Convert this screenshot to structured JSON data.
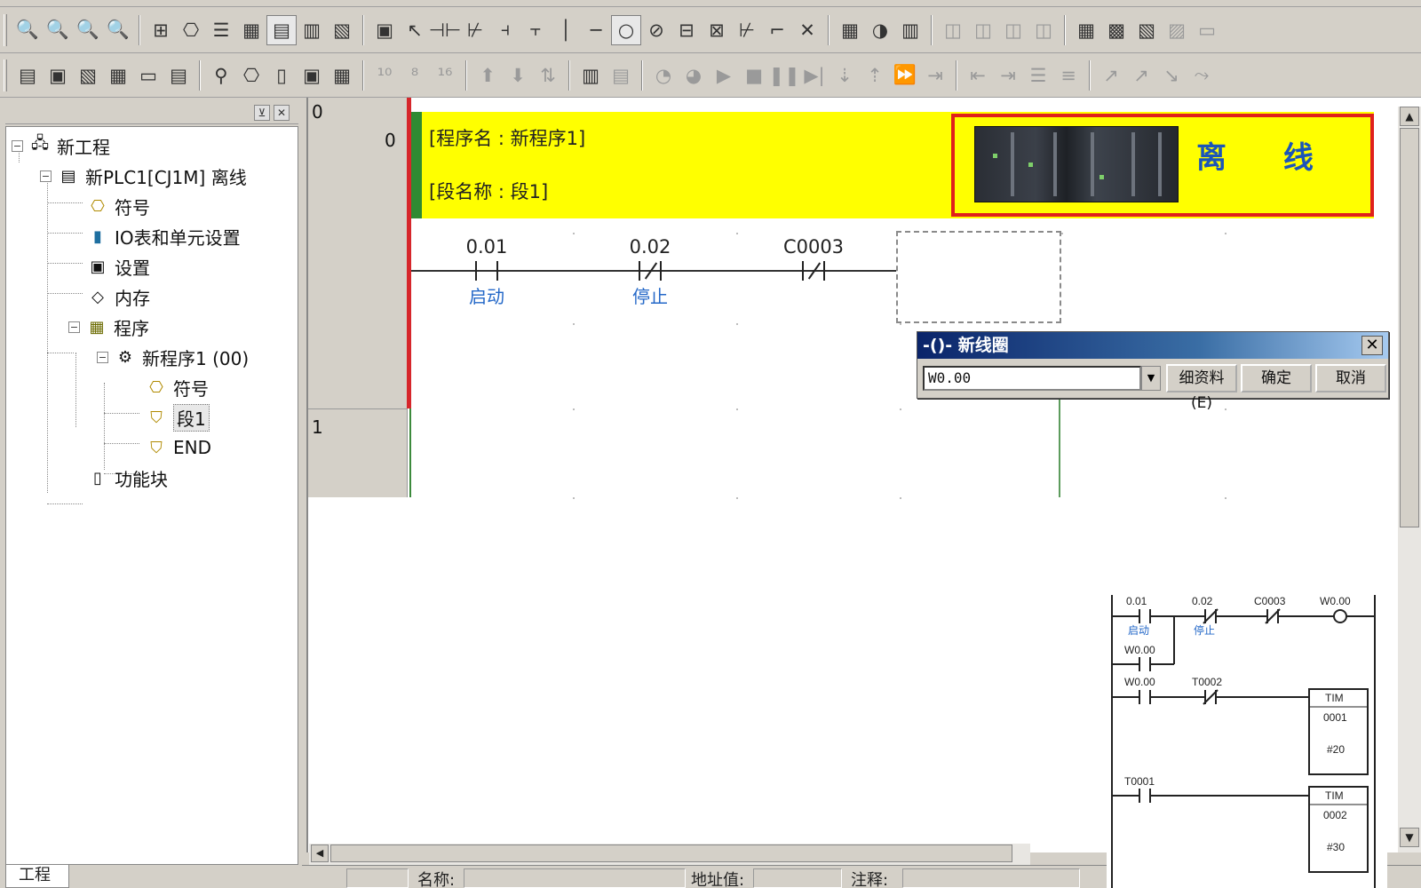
{
  "toolbar": {
    "row1": [
      "zoom-out-icon",
      "zoom-in-icon",
      "zoom-fit-icon",
      "zoom-small-icon",
      "grid-icon",
      "symbol-icon",
      "list-icon",
      "monitor-icon",
      "ladder-view-icon",
      "mnemonic-icon",
      "rung-comment-icon",
      "window-icon",
      "select-icon",
      "no-contact-icon",
      "nc-contact-icon",
      "or-no-icon",
      "or-nc-icon",
      "vertical-line-icon",
      "horizontal-line-icon",
      "coil-icon",
      "nc-coil-icon",
      "instruction-icon",
      "pd-contact-icon",
      "ft-contact-icon",
      "output-icon",
      "delete-icon",
      "compile-icon",
      "online-icon",
      "transfer-icon",
      "sym-icon1",
      "sym-icon2",
      "sym-icon3",
      "sym-icon4",
      "io-comment-icon",
      "memory-icon",
      "watch-icon",
      "diff-icon",
      "cross-ref-icon"
    ],
    "row2": [
      "project-icon",
      "properties-icon",
      "symbols-icon",
      "watch-window-icon",
      "output-window-icon",
      "cross-ref-window-icon",
      "find-icon",
      "io-table-icon",
      "settings-icon",
      "mem-icon",
      "plc-icon",
      "num-10-icon",
      "num-8-icon",
      "num-16-icon",
      "upload-icon",
      "download-icon",
      "compare-icon",
      "program-icon",
      "mode-icon",
      "force-icon",
      "monitor2-icon",
      "run-icon",
      "stop-icon",
      "pause-icon",
      "step-icon",
      "step-in-icon",
      "step-out-icon",
      "fast-icon",
      "end-icon",
      "indent-icon",
      "outdent-icon",
      "align-icon",
      "fold-icon",
      "bit-icon",
      "set-icon",
      "reset-icon",
      "clear-icon"
    ]
  },
  "tree": {
    "tab_label": "工程",
    "items": [
      {
        "label": "新工程",
        "icon": "project-tree-icon"
      },
      {
        "label": "新PLC1[CJ1M] 离线",
        "icon": "plc-tree-icon"
      },
      {
        "label": "符号",
        "icon": "symbols-tree-icon"
      },
      {
        "label": "IO表和单元设置",
        "icon": "io-table-tree-icon"
      },
      {
        "label": "设置",
        "icon": "settings-tree-icon"
      },
      {
        "label": "内存",
        "icon": "memory-tree-icon"
      },
      {
        "label": "程序",
        "icon": "programs-tree-icon"
      },
      {
        "label": "新程序1 (00)",
        "icon": "program-tree-icon"
      },
      {
        "label": "符号",
        "icon": "local-symbols-tree-icon"
      },
      {
        "label": "段1",
        "icon": "section-tree-icon"
      },
      {
        "label": "END",
        "icon": "end-section-tree-icon"
      },
      {
        "label": "功能块",
        "icon": "function-block-tree-icon"
      }
    ]
  },
  "editor": {
    "rung0_number": "0",
    "rung0_step": "0",
    "rung1_number": "1",
    "program_name": "[程序名 : 新程序1]",
    "section_name": "[段名称 : 段1]",
    "status_text": "离 线",
    "contacts": [
      {
        "address": "0.01",
        "comment": "启动",
        "type": "NO"
      },
      {
        "address": "0.02",
        "comment": "停止",
        "type": "NC"
      },
      {
        "address": "C0003",
        "comment": "",
        "type": "NC"
      }
    ]
  },
  "dialog": {
    "title": "-()- 新线圈",
    "input_value": "W0.00",
    "detail_label": "细资料 (E)",
    "ok_label": "确定",
    "cancel_label": "取消"
  },
  "statusbar": {
    "name_label": "名称:",
    "address_label": "地址值:",
    "comment_label": "注释:"
  },
  "reference": {
    "rung1": [
      {
        "address": "0.01",
        "comment": "启动",
        "type": "NO"
      },
      {
        "address": "0.02",
        "comment": "停止",
        "type": "NC"
      },
      {
        "address": "C0003",
        "comment": "",
        "type": "NC"
      },
      {
        "address": "W0.00",
        "comment": "",
        "type": "coil"
      }
    ],
    "branch": {
      "address": "W0.00",
      "type": "NO"
    },
    "rung2": [
      {
        "address": "W0.00",
        "type": "NO"
      },
      {
        "address": "T0002",
        "type": "NC"
      }
    ],
    "timer1": {
      "name": "TIM",
      "number": "0001",
      "preset": "#20"
    },
    "rung3": [
      {
        "address": "T0001",
        "type": "NO"
      }
    ],
    "timer2": {
      "name": "TIM",
      "number": "0002",
      "preset": "#30"
    }
  },
  "colors": {
    "banner": "#ffff00",
    "offline_border": "#e0201c",
    "offline_text": "#1b55b8",
    "comment_text": "#2468c8",
    "rail": "#d6262b"
  }
}
